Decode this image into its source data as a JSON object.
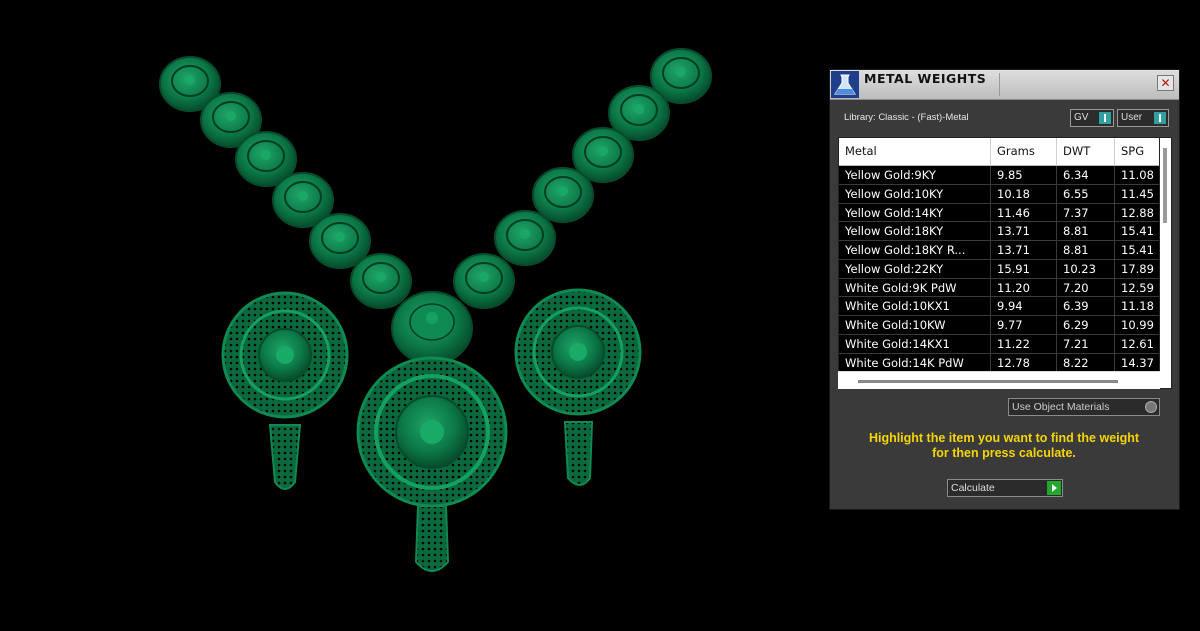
{
  "panel": {
    "title": "METAL WEIGHTS",
    "close_glyph": "✕",
    "library_label": "Library: Classic - (Fast)-Metal",
    "gv_toggle_label": "GV",
    "user_toggle_label": "User",
    "use_materials_label": "Use Object Materials",
    "instructions_line1": "Highlight the item you want to find the weight",
    "instructions_line2": "for then press calculate.",
    "calculate_label": "Calculate",
    "accent_color": "#f4d500",
    "go_button_color": "#22a82c",
    "toggle_color": "#30a0a0"
  },
  "table": {
    "headers": [
      "Metal",
      "Grams",
      "DWT",
      "SPG"
    ],
    "rows": [
      [
        "Yellow Gold:9KY",
        "9.85",
        "6.34",
        "11.08"
      ],
      [
        "Yellow Gold:10KY",
        "10.18",
        "6.55",
        "11.45"
      ],
      [
        "Yellow Gold:14KY",
        "11.46",
        "7.37",
        "12.88"
      ],
      [
        "Yellow Gold:18KY",
        "13.71",
        "8.81",
        "15.41"
      ],
      [
        "Yellow Gold:18KY R...",
        "13.71",
        "8.81",
        "15.41"
      ],
      [
        "Yellow Gold:22KY",
        "15.91",
        "10.23",
        "17.89"
      ],
      [
        "White Gold:9K PdW",
        "11.20",
        "7.20",
        "12.59"
      ],
      [
        "White Gold:10KX1",
        "9.94",
        "6.39",
        "11.18"
      ],
      [
        "White Gold:10KW",
        "9.77",
        "6.29",
        "10.99"
      ],
      [
        "White Gold:14KX1",
        "11.22",
        "7.21",
        "12.61"
      ],
      [
        "White Gold:14K PdW",
        "12.78",
        "8.22",
        "14.37"
      ]
    ]
  },
  "viewport": {
    "model_color": "#0f7a4a",
    "icons": [
      "necklace-model"
    ]
  }
}
